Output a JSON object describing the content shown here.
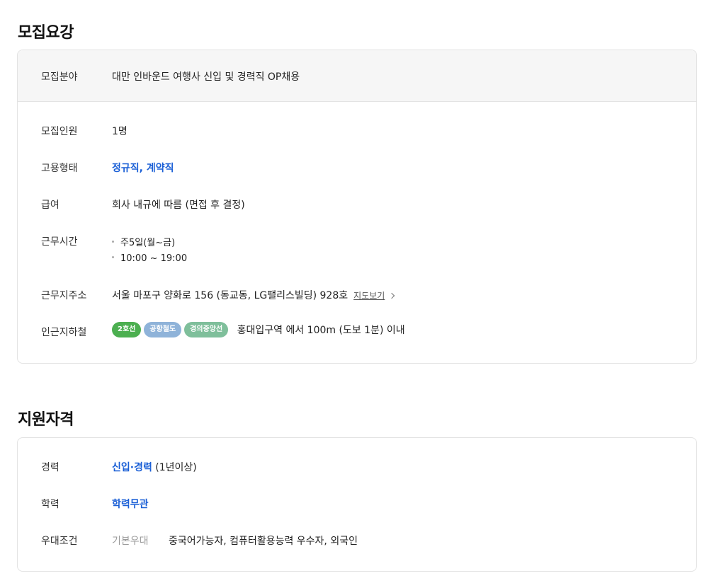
{
  "sections": {
    "recruit": {
      "title": "모집요강"
    },
    "qualification": {
      "title": "지원자격"
    }
  },
  "recruit": {
    "field": {
      "label": "모집분야",
      "value": "대만 인바운드 여행사 신입 및 경력직 OP채용"
    },
    "headcount": {
      "label": "모집인원",
      "value": "1명"
    },
    "employment": {
      "label": "고용형태",
      "value": "정규직, 계약직"
    },
    "salary": {
      "label": "급여",
      "value": "회사 내규에 따름 (면접 후 결정)"
    },
    "hours": {
      "label": "근무시간",
      "items": [
        "주5일(월~금)",
        "10:00 ~ 19:00"
      ]
    },
    "address": {
      "label": "근무지주소",
      "value": "서울 마포구 양화로 156 (동교동, LG팰리스빌딩) 928호",
      "map_link": "지도보기",
      "map_icon": "chevron-right-icon"
    },
    "subway": {
      "label": "인근지하철",
      "lines": [
        {
          "name": "2호선",
          "color": "#4caf50"
        },
        {
          "name": "공항철도",
          "color": "#8fb3d9"
        },
        {
          "name": "경의중앙선",
          "color": "#7fbf9b"
        }
      ],
      "station_text": "홍대입구역 에서 100m (도보 1분) 이내"
    }
  },
  "qualification": {
    "career": {
      "label": "경력",
      "value_blue": "신입·경력",
      "value_rest": " (1년이상)"
    },
    "education": {
      "label": "학력",
      "value": "학력무관"
    },
    "preference": {
      "label": "우대조건",
      "sub_label": "기본우대",
      "value": "중국어가능자, 컴퓨터활용능력 우수자, 외국인"
    }
  }
}
